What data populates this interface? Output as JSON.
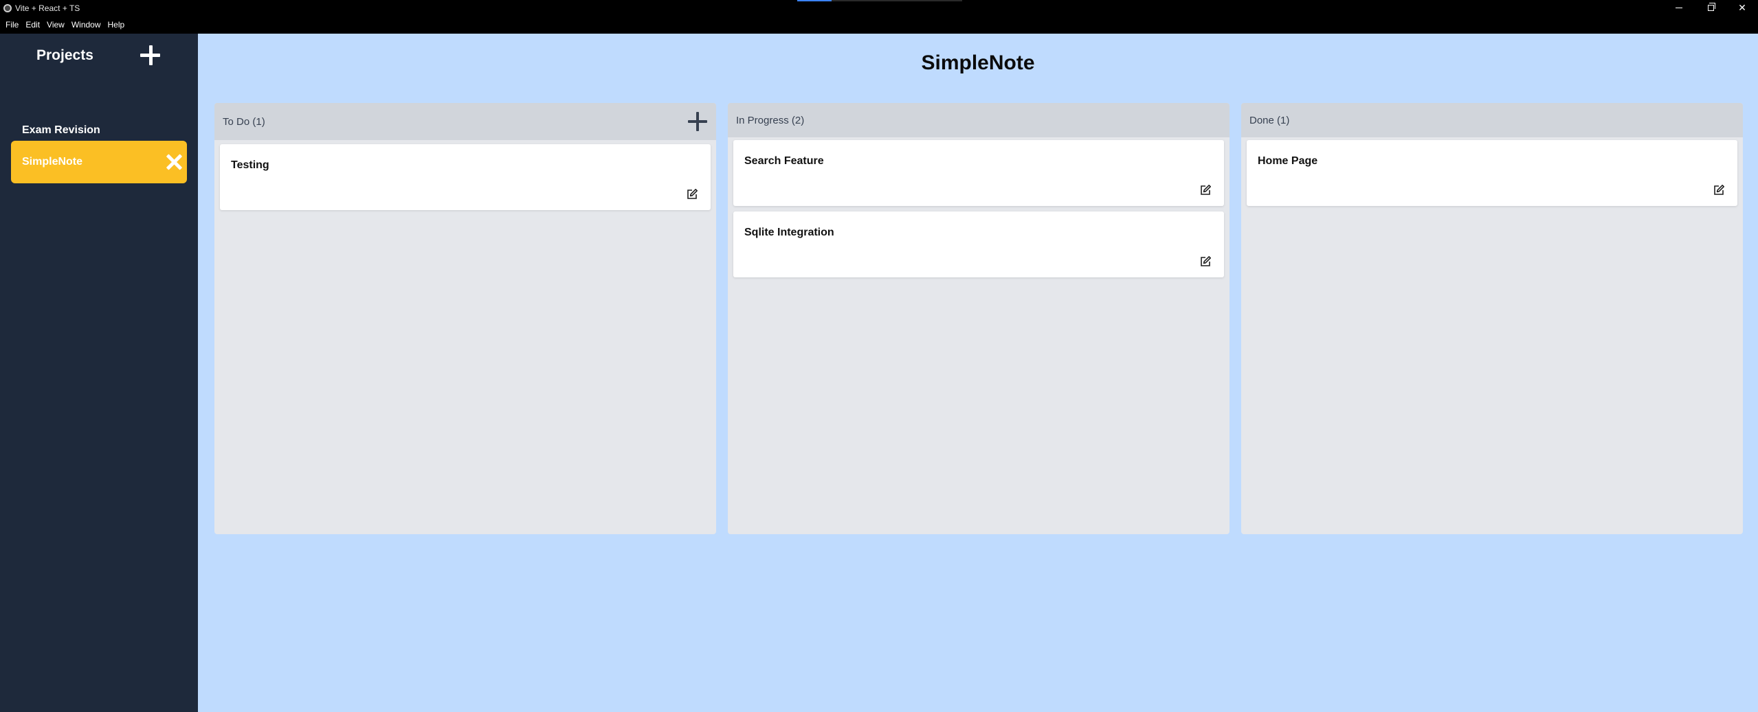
{
  "window": {
    "title": "Vite + React + TS"
  },
  "menu": [
    "File",
    "Edit",
    "View",
    "Window",
    "Help"
  ],
  "sidebar": {
    "title": "Projects",
    "projects": [
      {
        "label": "Exam Revision"
      },
      {
        "label": "SimpleNote"
      }
    ],
    "active_project": "SimpleNote",
    "active_color": "#fbbf24"
  },
  "main": {
    "title": "SimpleNote",
    "columns": [
      {
        "label": "To Do (1)",
        "cards": [
          {
            "title": "Testing"
          }
        ]
      },
      {
        "label": "In Progress (2)",
        "cards": [
          {
            "title": "Search Feature"
          },
          {
            "title": "Sqlite Integration"
          }
        ]
      },
      {
        "label": "Done (1)",
        "cards": [
          {
            "title": "Home Page"
          }
        ]
      }
    ]
  },
  "icons": {
    "add_project": "plus-icon",
    "close_project": "close-icon",
    "add_card": "plus-icon",
    "edit_card": "edit-icon"
  },
  "colors": {
    "sidebar_bg": "#1e293b",
    "main_bg": "#bfdbfe",
    "column_bg": "#e5e7eb",
    "column_header_bg": "#d1d5db"
  }
}
